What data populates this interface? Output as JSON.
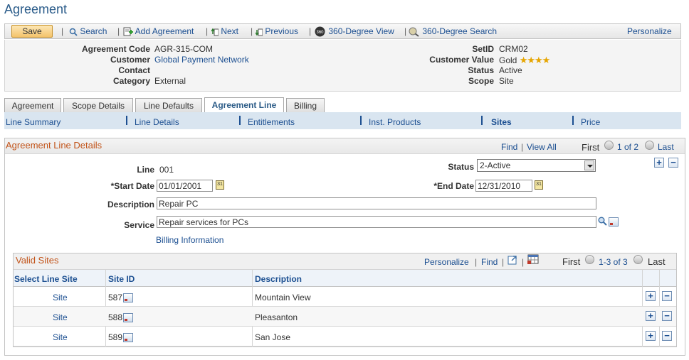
{
  "page": {
    "title": "Agreement"
  },
  "toolbar": {
    "save": "Save",
    "search": "Search",
    "add_agreement": "Add Agreement",
    "next": "Next",
    "previous": "Previous",
    "view360": "360-Degree View",
    "search360": "360-Degree Search",
    "personalize": "Personalize",
    "icon_360_text": "360"
  },
  "header": {
    "agreement_code_label": "Agreement Code",
    "agreement_code": "AGR-315-COM",
    "customer_label": "Customer",
    "customer": "Global Payment Network",
    "contact_label": "Contact",
    "category_label": "Category",
    "category": "External",
    "setid_label": "SetID",
    "setid": "CRM02",
    "customer_value_label": "Customer Value",
    "customer_value": "Gold",
    "customer_value_stars": 4,
    "status_label": "Status",
    "status": "Active",
    "scope_label": "Scope",
    "scope": "Site"
  },
  "tabs": [
    "Agreement",
    "Scope Details",
    "Line Defaults",
    "Agreement Line",
    "Billing"
  ],
  "subnav": [
    "Line Summary",
    "Line Details",
    "Entitlements",
    "Inst. Products",
    "Sites",
    "Price"
  ],
  "detail": {
    "title": "Agreement Line Details",
    "find": "Find",
    "view_all": "View All",
    "first": "First",
    "range": "1 of 2",
    "last": "Last",
    "line_label": "Line",
    "line": "001",
    "status_label": "Status",
    "status": "2-Active",
    "start_label": "*Start Date",
    "start_date": "01/01/2001",
    "end_label": "*End Date",
    "end_date": "12/31/2010",
    "description_label": "Description",
    "description": "Repair PC",
    "service_label": "Service",
    "service": "Repair services for PCs",
    "billing_info": "Billing Information",
    "calendar_glyph": "31"
  },
  "grid": {
    "title": "Valid Sites",
    "personalize": "Personalize",
    "find": "Find",
    "first": "First",
    "range": "1-3 of 3",
    "last": "Last",
    "columns": [
      "Select Line Site",
      "Site ID",
      "Description"
    ],
    "rows": [
      {
        "select": "Site",
        "site_id": "587",
        "description": "Mountain View"
      },
      {
        "select": "Site",
        "site_id": "588",
        "description": "Pleasanton"
      },
      {
        "select": "Site",
        "site_id": "589",
        "description": "San Jose"
      }
    ]
  }
}
